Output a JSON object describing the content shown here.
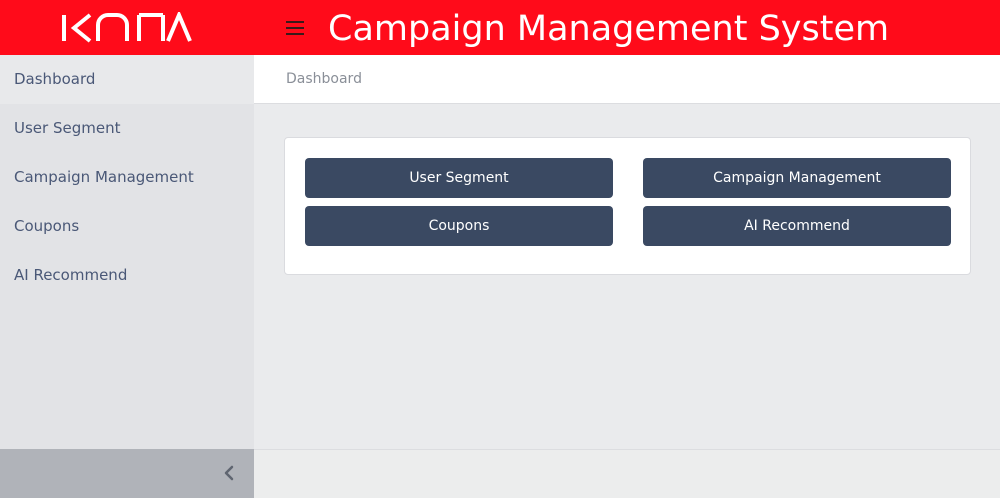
{
  "header": {
    "logo_text": "KONA",
    "title": "Campaign Management System",
    "background_color": "#ff0b1a",
    "menu_icon": "hamburger-menu-icon"
  },
  "sidebar": {
    "items": [
      {
        "label": "Dashboard",
        "active": true
      },
      {
        "label": "User Segment"
      },
      {
        "label": "Campaign Management"
      },
      {
        "label": "Coupons"
      },
      {
        "label": "AI Recommend"
      }
    ],
    "collapse_icon": "chevron-left-icon"
  },
  "breadcrumb": {
    "current": "Dashboard"
  },
  "dashboard": {
    "buttons": [
      {
        "label": "User Segment"
      },
      {
        "label": "Campaign Management"
      },
      {
        "label": "Coupons"
      },
      {
        "label": "AI Recommend"
      }
    ],
    "button_color": "#3a4962"
  }
}
